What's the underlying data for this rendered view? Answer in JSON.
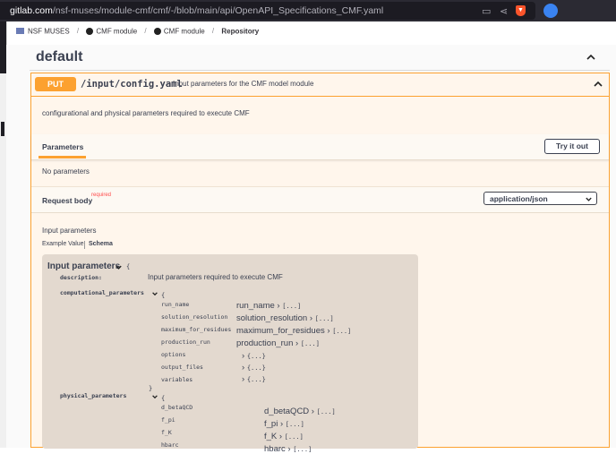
{
  "browser": {
    "url_host": "gitlab.com",
    "url_path": "/nsf-muses/module-cmf/cmf/-/blob/main/api/OpenAPI_Specifications_CMF.yaml"
  },
  "breadcrumb": [
    "NSF MUSES",
    "CMF module",
    "CMF module",
    "Repository"
  ],
  "section": {
    "title": "default"
  },
  "operation": {
    "method": "PUT",
    "path": "/input/config.yaml",
    "summary": "Input parameters for the CMF model module",
    "description": "configurational and physical parameters required to execute CMF",
    "parameters_tab": "Parameters",
    "try_out_label": "Try it out",
    "no_params": "No parameters",
    "request_body_label": "Request body",
    "required_label": "required",
    "content_type": "application/json",
    "body_description": "Input parameters",
    "example_tab": "Example Value",
    "schema_tab": "Schema"
  },
  "model": {
    "title": "Input parameters",
    "brace_open": "{",
    "brace_close": "}",
    "description_key": "description:",
    "description_value": "Input parameters required to execute CMF",
    "computational_key": "computational_parameters",
    "computational_items": [
      "run_name",
      "solution_resolution",
      "maximum_for_residues",
      "production_run",
      "options",
      "output_files",
      "variables"
    ],
    "computational_expanded": [
      "run_name",
      "solution_resolution",
      "maximum_for_residues",
      "production_run"
    ],
    "collapsed_marker": "[...]",
    "object_marker": "{...}",
    "physical_key": "physical_parameters",
    "physical_items": [
      "d_betaQCD",
      "f_pi",
      "f_K",
      "hbarc"
    ],
    "physical_expanded": [
      "d_betaQCD",
      "f_pi",
      "f_K",
      "hbarc"
    ]
  }
}
